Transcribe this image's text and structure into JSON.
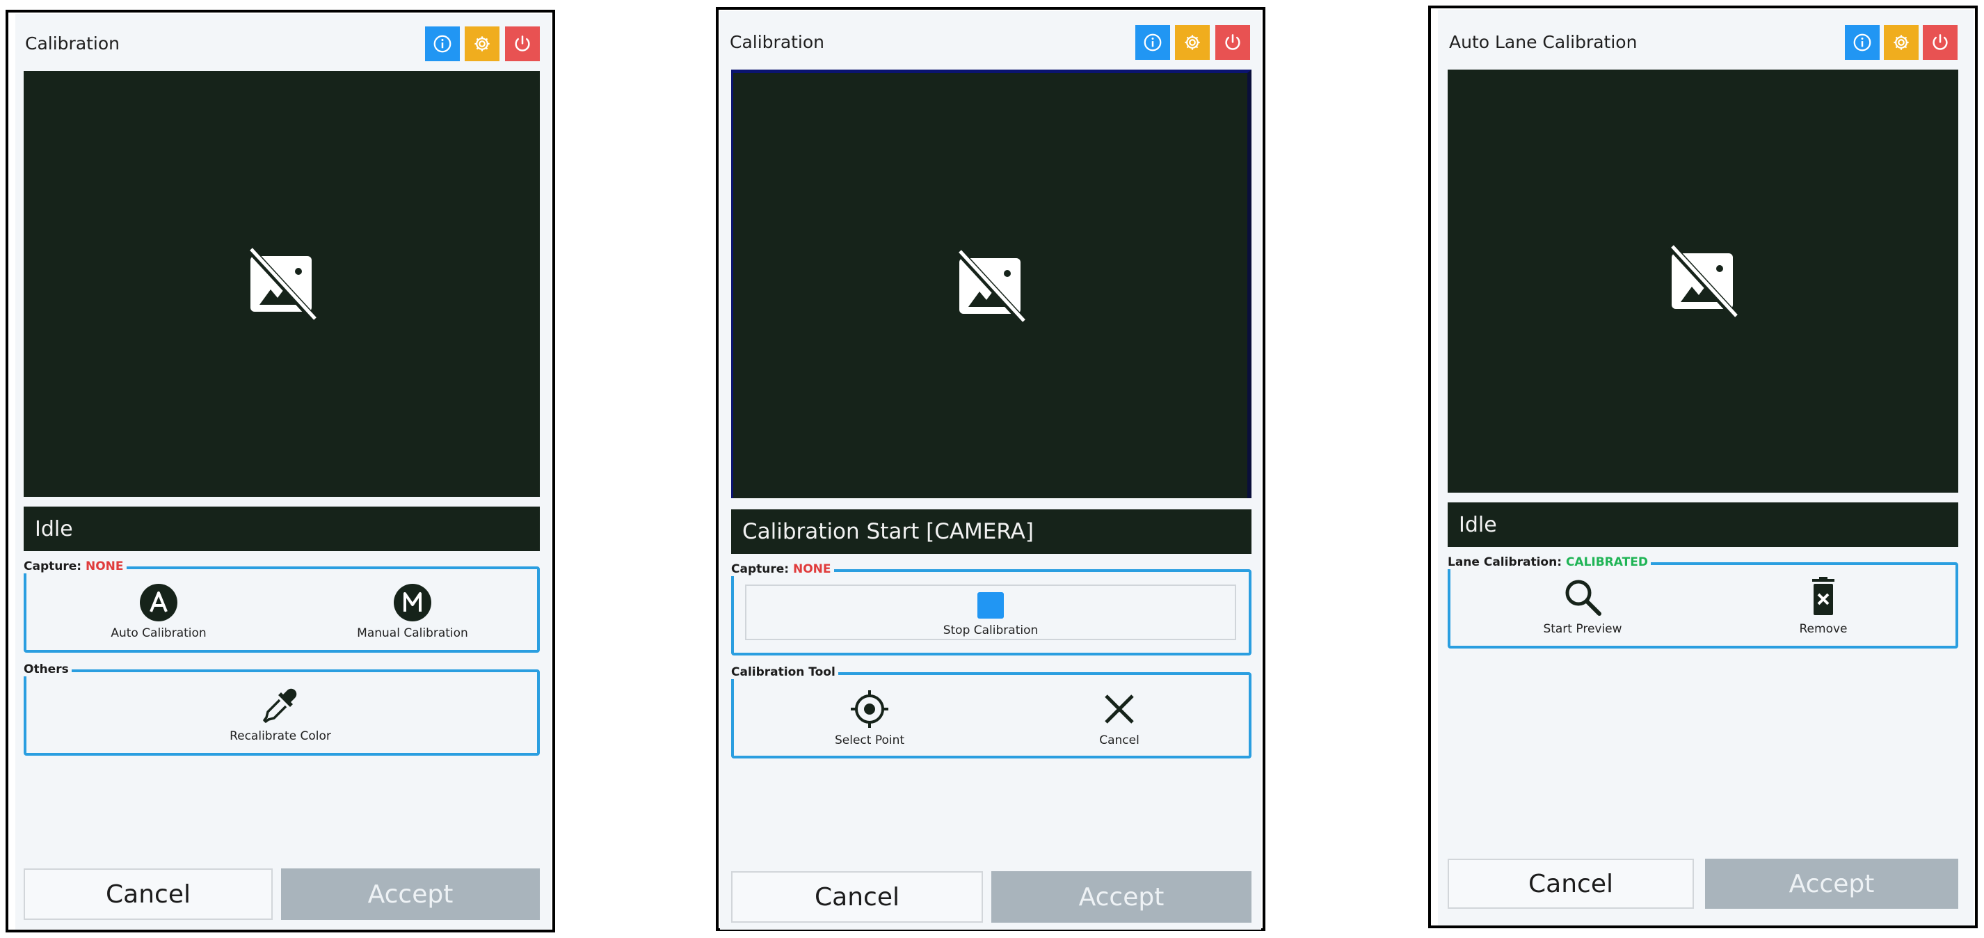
{
  "colors": {
    "info": "#2196f3",
    "settings": "#f0ad1e",
    "power": "#e85252",
    "preview_bg": "#16231a",
    "group_border": "#2a9ee0",
    "status_none": "#e03c3c",
    "status_calibrated": "#1fb455",
    "accept_disabled": "#a9b4bc"
  },
  "panels": [
    {
      "title": "Calibration",
      "status": "Idle",
      "capture": {
        "label": "Capture:",
        "state": "NONE",
        "actions": [
          {
            "icon": "auto-a-icon",
            "label": "Auto Calibration"
          },
          {
            "icon": "manual-m-icon",
            "label": "Manual Calibration"
          }
        ]
      },
      "others": {
        "label": "Others",
        "actions": [
          {
            "icon": "eyedropper-icon",
            "label": "Recalibrate Color"
          }
        ]
      },
      "cancel_label": "Cancel",
      "accept_label": "Accept"
    },
    {
      "title": "Calibration",
      "status": "Calibration Start [CAMERA]",
      "capture": {
        "label": "Capture:",
        "state": "NONE",
        "actions": [
          {
            "icon": "stop-icon",
            "label": "Stop Calibration"
          }
        ]
      },
      "tool": {
        "label": "Calibration Tool",
        "actions": [
          {
            "icon": "crosshair-icon",
            "label": "Select Point"
          },
          {
            "icon": "close-icon",
            "label": "Cancel"
          }
        ]
      },
      "cancel_label": "Cancel",
      "accept_label": "Accept"
    },
    {
      "title": "Auto Lane Calibration",
      "status": "Idle",
      "lane": {
        "label": "Lane Calibration:",
        "state": "CALIBRATED",
        "actions": [
          {
            "icon": "search-icon",
            "label": "Start Preview"
          },
          {
            "icon": "trash-icon",
            "label": "Remove"
          }
        ]
      },
      "cancel_label": "Cancel",
      "accept_label": "Accept"
    }
  ]
}
